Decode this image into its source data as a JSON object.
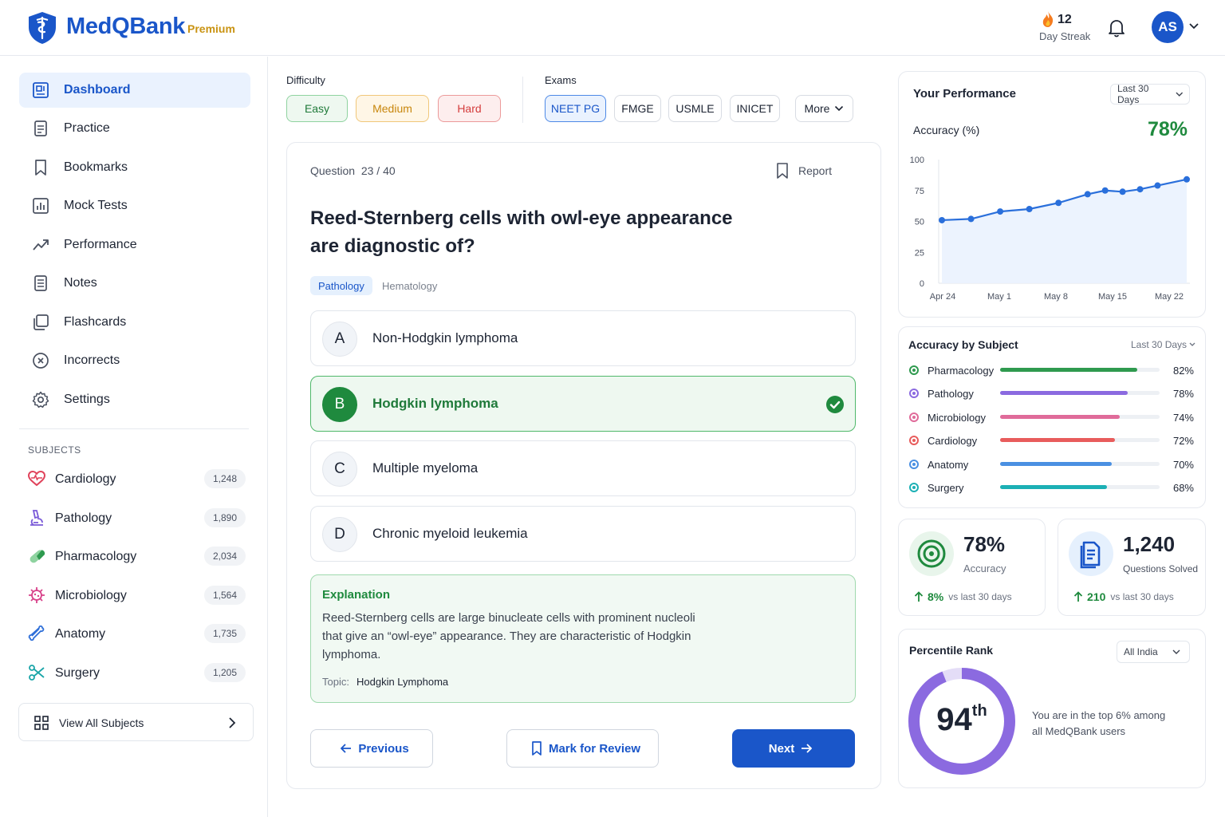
{
  "app": {
    "name": "MedQBank",
    "plan": "Premium"
  },
  "header": {
    "streak_count": "12",
    "streak_label": "Day Streak",
    "avatar_initials": "AS"
  },
  "sidebar": {
    "nav": [
      {
        "label": "Dashboard",
        "icon": "dashboard-icon",
        "active": true
      },
      {
        "label": "Practice",
        "icon": "practice-icon"
      },
      {
        "label": "Bookmarks",
        "icon": "bookmark-icon"
      },
      {
        "label": "Mock Tests",
        "icon": "bar-chart-icon"
      },
      {
        "label": "Performance",
        "icon": "trend-icon"
      },
      {
        "label": "Notes",
        "icon": "notes-icon"
      },
      {
        "label": "Flashcards",
        "icon": "flashcards-icon"
      },
      {
        "label": "Incorrects",
        "icon": "x-circle-icon"
      },
      {
        "label": "Settings",
        "icon": "gear-icon"
      }
    ],
    "subjects_title": "SUBJECTS",
    "subjects": [
      {
        "label": "Cardiology",
        "count": "1,248",
        "color": "#e0435b"
      },
      {
        "label": "Pathology",
        "count": "1,890",
        "color": "#7a5ad8"
      },
      {
        "label": "Pharmacology",
        "count": "2,034",
        "color": "#2f9a4f"
      },
      {
        "label": "Microbiology",
        "count": "1,564",
        "color": "#d8428a"
      },
      {
        "label": "Anatomy",
        "count": "1,735",
        "color": "#2f6fd8"
      },
      {
        "label": "Surgery",
        "count": "1,205",
        "color": "#1aa5a8"
      }
    ],
    "view_all": "View All Subjects"
  },
  "filters": {
    "difficulty_label": "Difficulty",
    "difficulty": [
      "Easy",
      "Medium",
      "Hard"
    ],
    "exams_label": "Exams",
    "exams": [
      "NEET PG",
      "FMGE",
      "USMLE",
      "INICET"
    ],
    "selected_exam": "NEET PG",
    "more": "More"
  },
  "question": {
    "label": "Question",
    "progress": "23 / 40",
    "report": "Report",
    "text": "Reed-Sternberg cells with owl-eye appearance are diagnostic of?",
    "tags": [
      "Pathology",
      "Hematology"
    ],
    "options": [
      {
        "letter": "A",
        "text": "Non-Hodgkin lymphoma"
      },
      {
        "letter": "B",
        "text": "Hodgkin lymphoma",
        "correct": true
      },
      {
        "letter": "C",
        "text": "Multiple myeloma"
      },
      {
        "letter": "D",
        "text": "Chronic myeloid leukemia"
      }
    ],
    "explanation_title": "Explanation",
    "explanation": "Reed-Sternberg cells are large binucleate cells with prominent nucleoli that give an “owl-eye” appearance. They are characteristic of Hodgkin lymphoma.",
    "topic_label": "Topic:",
    "topic": "Hodgkin Lymphoma",
    "prev": "Previous",
    "mark": "Mark for Review",
    "next": "Next"
  },
  "performance": {
    "title": "Your Performance",
    "range": "Last 30 Days",
    "metric_label": "Accuracy (%)",
    "metric_value": "78%"
  },
  "chart_data": {
    "type": "line",
    "title": "",
    "ylabel": "",
    "x_ticks": [
      "Apr 24",
      "May 1",
      "May 8",
      "May 15",
      "May 22"
    ],
    "y_ticks": [
      0,
      25,
      50,
      75,
      100
    ],
    "ylim": [
      0,
      100
    ],
    "xlim_days": [
      0,
      30
    ],
    "series": [
      {
        "x": [
          0,
          5,
          10,
          15,
          20,
          25,
          28,
          31,
          34,
          37,
          42
        ],
        "values": [
          51,
          52,
          58,
          60,
          65,
          72,
          75,
          74,
          76,
          79,
          84
        ]
      }
    ],
    "color": "#2a6fdb",
    "grid": false
  },
  "accuracy_by_subject": {
    "title": "Accuracy by Subject",
    "range": "Last 30 Days",
    "rows": [
      {
        "name": "Pharmacology",
        "pct": "82%",
        "value": 0.86,
        "color": "#2f9a4f"
      },
      {
        "name": "Pathology",
        "pct": "78%",
        "value": 0.8,
        "color": "#8b6ae0"
      },
      {
        "name": "Microbiology",
        "pct": "74%",
        "value": 0.75,
        "color": "#e06b9a"
      },
      {
        "name": "Cardiology",
        "pct": "72%",
        "value": 0.72,
        "color": "#e85c5c"
      },
      {
        "name": "Anatomy",
        "pct": "70%",
        "value": 0.7,
        "color": "#4a90e2"
      },
      {
        "name": "Surgery",
        "pct": "68%",
        "value": 0.67,
        "color": "#1cb0b5"
      }
    ]
  },
  "stats": {
    "accuracy_value": "78%",
    "accuracy_label": "Accuracy",
    "accuracy_delta": "8%",
    "accuracy_delta_label": "vs last 30 days",
    "solved_value": "1,240",
    "solved_label": "Questions Solved",
    "solved_delta": "210",
    "solved_delta_label": "vs last 30 days"
  },
  "percentile": {
    "title": "Percentile Rank",
    "scope": "All India",
    "value": "94",
    "suffix": "th",
    "note": "You are in the top 6% among all MedQBank users",
    "fraction": 0.94
  }
}
